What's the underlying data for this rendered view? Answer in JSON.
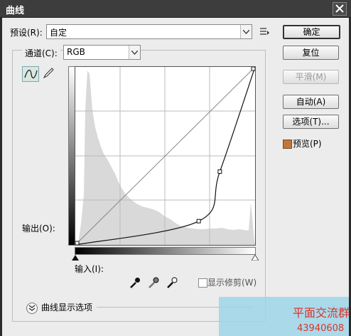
{
  "window": {
    "title": "曲线"
  },
  "preset": {
    "label": "预设(R):",
    "value": "自定"
  },
  "channel": {
    "label": "通道(C):",
    "value": "RGB"
  },
  "buttons": {
    "ok": "确定",
    "reset": "复位",
    "smooth": "平滑(M)",
    "auto": "自动(A)",
    "options": "选项(T)...",
    "preview": "预览(P)"
  },
  "curve": {
    "output_label": "输出(O):",
    "input_label": "输入(I):",
    "show_clipping": "显示修剪(W)",
    "display_options": "曲线显示选项",
    "points": [
      [
        0,
        0
      ],
      [
        175,
        34
      ],
      [
        205,
        105
      ],
      [
        255,
        255
      ]
    ]
  },
  "watermark": {
    "line1": "平面交流群",
    "line2": "43940608"
  },
  "colors": {
    "titlebar": "#3d3d3d",
    "preview": "#c0763a",
    "watermark_text": "#d9352a"
  }
}
